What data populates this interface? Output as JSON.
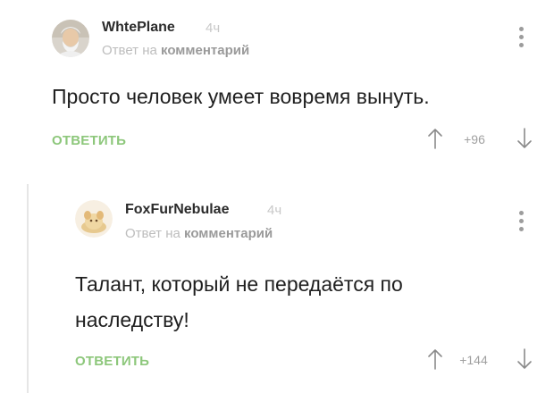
{
  "comments": [
    {
      "author": "WhtePlane",
      "time": "4ч",
      "reply_prefix": "Ответ на",
      "reply_link": "комментарий",
      "text": "Просто человек умеет вовремя вынуть.",
      "reply_label": "ОТВЕТИТЬ",
      "rating": "+96"
    },
    {
      "author": "FoxFurNebulae",
      "time": "4ч",
      "reply_prefix": "Ответ на",
      "reply_link": "комментарий",
      "text_line_1": "Талант, который не передаётся по",
      "text_line_2": "наследству!",
      "reply_label": "ОТВЕТИТЬ",
      "rating": "+144"
    }
  ],
  "colors": {
    "reply_button": "#8dc77b",
    "author": "#2b2b2b",
    "muted": "#bdbdbd",
    "thread_line": "#e6e6e6"
  },
  "icons": {
    "vote_up": "arrow-up-icon",
    "vote_down": "arrow-down-icon",
    "menu": "more-vertical-icon"
  }
}
